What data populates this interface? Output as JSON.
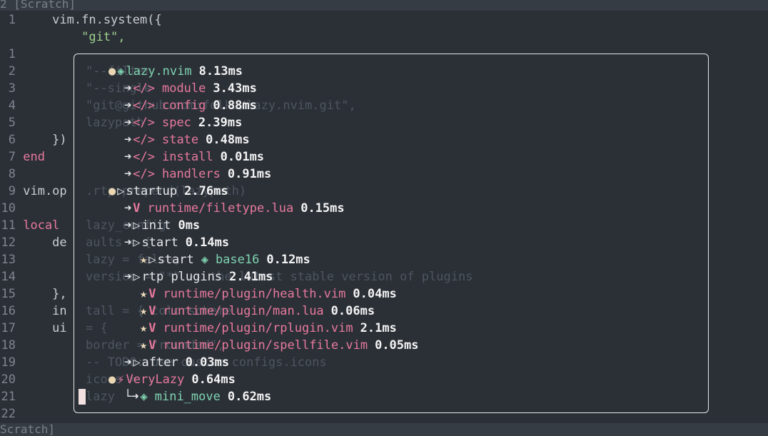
{
  "top_bar": {
    "title": "2 [Scratch]"
  },
  "bottom_bar": {
    "title": "Scratch]"
  },
  "editor_lines": [
    {
      "n": "1",
      "code": "    vim.fn.system({"
    },
    {
      "n": "",
      "code": "        \"git\","
    },
    {
      "n": "1",
      "code": ""
    },
    {
      "n": "2",
      "code": ""
    },
    {
      "n": "3",
      "code": ""
    },
    {
      "n": "4",
      "code": ""
    },
    {
      "n": "5",
      "code": ""
    },
    {
      "n": "6",
      "code": "    })"
    },
    {
      "n": "7",
      "code": "end"
    },
    {
      "n": "8",
      "code": ""
    },
    {
      "n": "9",
      "code": "vim.op"
    },
    {
      "n": "10",
      "code": ""
    },
    {
      "n": "11",
      "code": "local"
    },
    {
      "n": "12",
      "code": "    de"
    },
    {
      "n": "13",
      "code": ""
    },
    {
      "n": "14",
      "code": ""
    },
    {
      "n": "15",
      "code": "    },"
    },
    {
      "n": "16",
      "code": "    in"
    },
    {
      "n": "17",
      "code": "    ui"
    },
    {
      "n": "18",
      "code": ""
    },
    {
      "n": "19",
      "code": ""
    },
    {
      "n": "20",
      "code": ""
    },
    {
      "n": "21",
      "code": ""
    },
    {
      "n": "22",
      "code": ""
    }
  ],
  "ghost_lines": [
    {
      "text": "\"--filter",
      "row": 1
    },
    {
      "text": "\"--single",
      "row": 2
    },
    {
      "text": "\"git@github.com:folke/lazy.nvim.git\",",
      "row": 3
    },
    {
      "text": "lazypath",
      "row": 4
    },
    {
      "text": ".rtp:prepend(lazypath)",
      "row": 8
    },
    {
      "text": "lazy_config",
      "row": 10
    },
    {
      "text": "aults = {",
      "row": 11
    },
    {
      "text": "lazy = false,",
      "row": 12
    },
    {
      "text": "version = \"*\" -- the latest stable version of plugins",
      "row": 13
    },
    {
      "text": "tall = { colorscheme",
      "row": 15
    },
    {
      "text": "= {",
      "row": 16
    },
    {
      "text": "border = \"rounded\",",
      "row": 17
    },
    {
      "text": "-- TODO: use custom configs.icons",
      "row": 18
    },
    {
      "text": "icons = ",
      "row": 19
    },
    {
      "text": "lazy",
      "row": 20
    }
  ],
  "profile_rows": [
    {
      "indent": 1,
      "lead": "●",
      "icon": "◈",
      "name": "lazy.nvim",
      "time": "8.13ms",
      "style": "plugin-root"
    },
    {
      "indent": 2,
      "lead": "➜",
      "icon": "</>",
      "name": "module",
      "time": "3.43ms",
      "style": "module"
    },
    {
      "indent": 2,
      "lead": "➜",
      "icon": "</>",
      "name": "config",
      "time": "0.88ms",
      "style": "module"
    },
    {
      "indent": 2,
      "lead": "➜",
      "icon": "</>",
      "name": "spec",
      "time": "2.39ms",
      "style": "module"
    },
    {
      "indent": 2,
      "lead": "➜",
      "icon": "</>",
      "name": "state",
      "time": "0.48ms",
      "style": "module"
    },
    {
      "indent": 2,
      "lead": "➜",
      "icon": "</>",
      "name": "install",
      "time": "0.01ms",
      "style": "module"
    },
    {
      "indent": 2,
      "lead": "➜",
      "icon": "</>",
      "name": "handlers",
      "time": "0.91ms",
      "style": "module"
    },
    {
      "indent": 1,
      "lead": "●",
      "icon": "▷",
      "name": "startup",
      "time": "2.76ms",
      "style": "event"
    },
    {
      "indent": 2,
      "lead": "➜",
      "icon": "V",
      "name": "runtime/filetype.lua",
      "time": "0.15ms",
      "style": "runtime"
    },
    {
      "indent": 2,
      "lead": "➜",
      "icon": "▷",
      "name": "init",
      "time": "0ms",
      "style": "event"
    },
    {
      "indent": 2,
      "lead": "➜",
      "icon": "▷",
      "name": "start",
      "time": "0.14ms",
      "style": "event"
    },
    {
      "indent": 3,
      "lead": "★",
      "icon": "▷",
      "name": "start",
      "extra_icon": "◈",
      "extra": "base16",
      "time": "0.12ms",
      "style": "event-plugin"
    },
    {
      "indent": 2,
      "lead": "➜",
      "icon": "▷",
      "name": "rtp plugins",
      "time": "2.41ms",
      "style": "event"
    },
    {
      "indent": 3,
      "lead": "★",
      "icon": "V",
      "name": "runtime/plugin/health.vim",
      "time": "0.04ms",
      "style": "runtime"
    },
    {
      "indent": 3,
      "lead": "★",
      "icon": "V",
      "name": "runtime/plugin/man.lua",
      "time": "0.06ms",
      "style": "runtime"
    },
    {
      "indent": 3,
      "lead": "★",
      "icon": "V",
      "name": "runtime/plugin/rplugin.vim",
      "time": "2.1ms",
      "style": "runtime"
    },
    {
      "indent": 3,
      "lead": "★",
      "icon": "V",
      "name": "runtime/plugin/spellfile.vim",
      "time": "0.05ms",
      "style": "runtime"
    },
    {
      "indent": 2,
      "lead": "➜",
      "icon": "▷",
      "name": "after",
      "time": "0.03ms",
      "style": "event"
    },
    {
      "indent": 1,
      "lead": "●",
      "icon": "⚡",
      "name": "VeryLazy",
      "time": "0.64ms",
      "style": "lazy-event"
    },
    {
      "indent": 2,
      "lead": "└➜",
      "icon": "◈",
      "name": "mini_move",
      "time": "0.62ms",
      "style": "plugin"
    }
  ]
}
